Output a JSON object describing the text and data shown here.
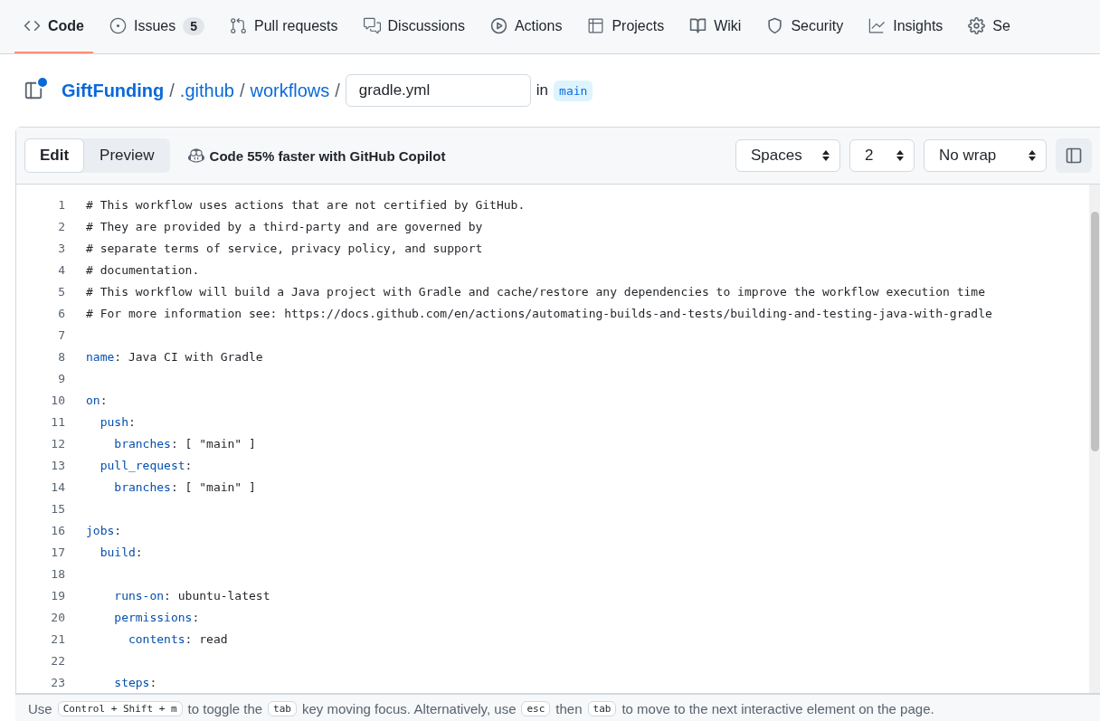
{
  "repo_tabs": [
    {
      "label": "Code",
      "selected": true
    },
    {
      "label": "Issues",
      "count": "5",
      "selected": false
    },
    {
      "label": "Pull requests",
      "selected": false
    },
    {
      "label": "Discussions",
      "selected": false
    },
    {
      "label": "Actions",
      "selected": false
    },
    {
      "label": "Projects",
      "selected": false
    },
    {
      "label": "Wiki",
      "selected": false
    },
    {
      "label": "Security",
      "selected": false
    },
    {
      "label": "Insights",
      "selected": false
    },
    {
      "label": "Se",
      "selected": false
    }
  ],
  "breadcrumb": {
    "repo": "GiftFunding",
    "folders": [
      ".github",
      "workflows"
    ],
    "separators": [
      "/",
      "/",
      "/"
    ],
    "filename": "gradle.yml",
    "in_label": "in",
    "branch": "main"
  },
  "toolbar": {
    "modes": [
      {
        "label": "Edit",
        "selected": true
      },
      {
        "label": "Preview",
        "selected": false
      }
    ],
    "copilot": "Code 55% faster with GitHub Copilot",
    "selects": [
      "Spaces",
      "2",
      "No wrap"
    ]
  },
  "code_lines": [
    {
      "number": "1",
      "rest": "# This workflow uses actions that are not certified by GitHub."
    },
    {
      "number": "2",
      "rest": "# They are provided by a third-party and are governed by"
    },
    {
      "number": "3",
      "rest": "# separate terms of service, privacy policy, and support"
    },
    {
      "number": "4",
      "rest": "# documentation."
    },
    {
      "number": "5",
      "rest": "# This workflow will build a Java project with Gradle and cache/restore any dependencies to improve the workflow execution time"
    },
    {
      "number": "6",
      "rest": "# For more information see: https://docs.github.com/en/actions/automating-builds-and-tests/building-and-testing-java-with-gradle"
    },
    {
      "number": "7"
    },
    {
      "number": "8",
      "key": "name",
      "rest": ": Java CI with Gradle"
    },
    {
      "number": "9"
    },
    {
      "number": "10",
      "key": "on",
      "rest": ":"
    },
    {
      "number": "11",
      "key": "  push",
      "rest": ":"
    },
    {
      "number": "12",
      "key": "    branches",
      "rest": ": [ \"main\" ]"
    },
    {
      "number": "13",
      "key": "  pull_request",
      "rest": ":"
    },
    {
      "number": "14",
      "key": "    branches",
      "rest": ": [ \"main\" ]"
    },
    {
      "number": "15"
    },
    {
      "number": "16",
      "key": "jobs",
      "rest": ":"
    },
    {
      "number": "17",
      "key": "  build",
      "rest": ":"
    },
    {
      "number": "18"
    },
    {
      "number": "19",
      "key": "    runs-on",
      "rest": ": ubuntu-latest"
    },
    {
      "number": "20",
      "key": "    permissions",
      "rest": ":"
    },
    {
      "number": "21",
      "key": "      contents",
      "rest": ": read"
    },
    {
      "number": "22"
    },
    {
      "number": "23",
      "key": "    steps",
      "rest": ":"
    }
  ],
  "help_bar": [
    {
      "kind": "text",
      "text": "Use"
    },
    {
      "kind": "key",
      "text": "Control + Shift + m"
    },
    {
      "kind": "text",
      "text": "to toggle the"
    },
    {
      "kind": "key",
      "text": "tab"
    },
    {
      "kind": "text",
      "text": "key moving focus. Alternatively, use"
    },
    {
      "kind": "key",
      "text": "esc"
    },
    {
      "kind": "text",
      "text": "then"
    },
    {
      "kind": "key",
      "text": "tab"
    },
    {
      "kind": "text",
      "text": "to move to the next interactive element on the page."
    }
  ]
}
